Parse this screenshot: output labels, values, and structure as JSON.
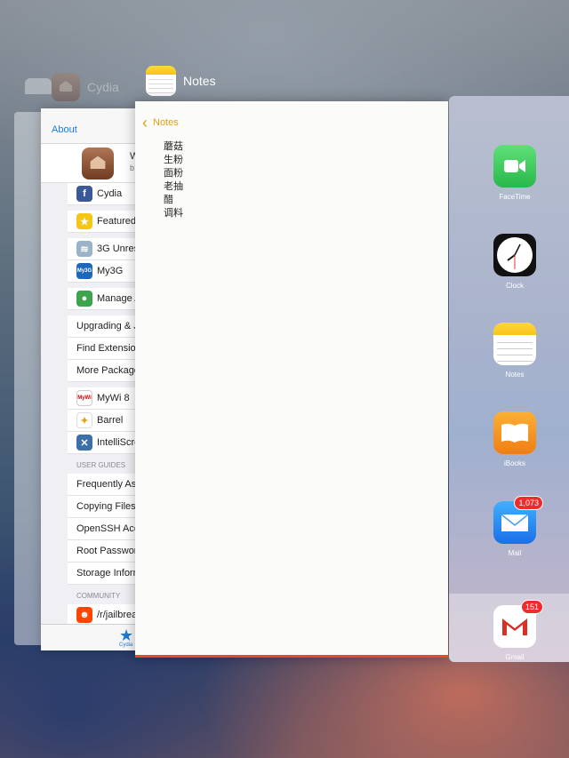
{
  "switcher": {
    "cydia_header": "Cydia",
    "notes_header": "Notes"
  },
  "cydia": {
    "nav_back": "About",
    "header_partial": "W",
    "header_sub": "b",
    "rows_group1": [
      "Cydia"
    ],
    "rows_group2": [
      "Featured"
    ],
    "rows_group3": [
      "3G Unrest",
      "My3G"
    ],
    "rows_group4": [
      "Manage A"
    ],
    "rows_group5": [
      "Upgrading & J",
      "Find Extension",
      "More Package"
    ],
    "rows_group6": [
      "MyWi 8",
      "Barrel",
      "IntelliScre"
    ],
    "section_guides": "USER GUIDES",
    "rows_guides": [
      "Frequently Ask",
      "Copying Files",
      "OpenSSH Acc",
      "Root Passwor",
      "Storage Inform"
    ],
    "section_community": "COMMUNITY",
    "rows_community": [
      "/r/jailbreak"
    ],
    "tab_label": "Cydia",
    "mywi_suffix": "Y"
  },
  "notes": {
    "back_label": "Notes",
    "lines": [
      "蘑菇",
      "生粉",
      "面粉",
      "老抽",
      "醋",
      "调料"
    ]
  },
  "home": {
    "apps": [
      {
        "name": "FaceTime",
        "icon": "facetime-icon",
        "color": "#34c759"
      },
      {
        "name": "Clock",
        "icon": "clock-icon",
        "color": "#111111"
      },
      {
        "name": "Notes",
        "icon": "notes-icon",
        "color": "#ffd63a"
      },
      {
        "name": "iBooks",
        "icon": "ibooks-icon",
        "color": "#f59a1c"
      },
      {
        "name": "Mail",
        "icon": "mail-icon",
        "color": "#1e8cf0",
        "badge": "1,073"
      }
    ],
    "dock_app": {
      "name": "Gmail",
      "icon": "gmail-icon",
      "badge": "151"
    }
  }
}
